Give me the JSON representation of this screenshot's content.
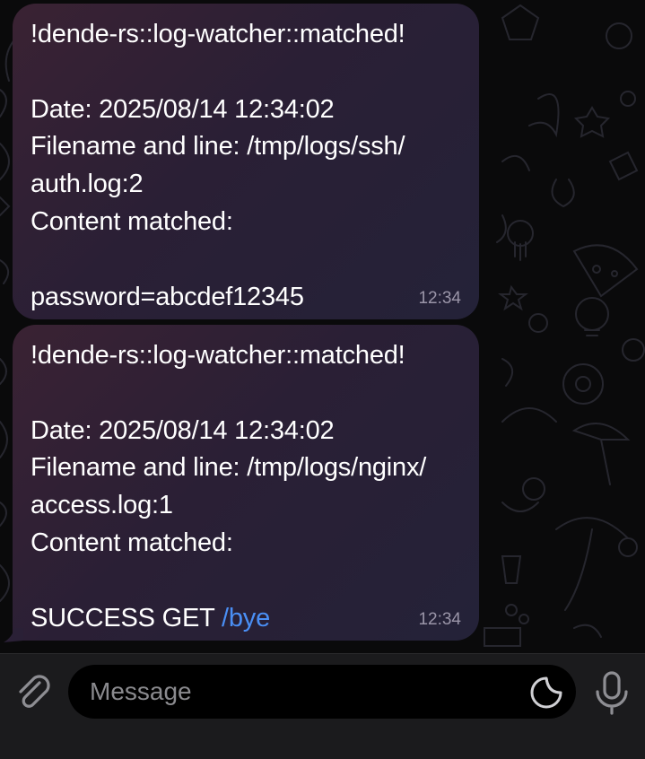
{
  "messages": [
    {
      "lines": [
        "!dende-rs::log-watcher::matched!",
        "",
        "Date: 2025/08/14 12:34:02",
        "Filename and line: /tmp/logs/ssh/",
        "auth.log:2",
        "Content matched:",
        "",
        "password=abcdef12345"
      ],
      "time": "12:34"
    },
    {
      "lines": [
        "!dende-rs::log-watcher::matched!",
        "",
        "Date: 2025/08/14 12:34:02",
        "Filename and line: /tmp/logs/nginx/",
        "access.log:1",
        "Content matched:",
        ""
      ],
      "last_line_prefix": "SUCCESS GET ",
      "last_line_command": "/bye",
      "time": "12:34"
    }
  ],
  "input": {
    "placeholder": "Message",
    "value": ""
  },
  "icons": {
    "attach": "paperclip-icon",
    "sticker": "sticker-icon",
    "mic": "microphone-icon"
  },
  "colors": {
    "link": "#4a8ff5",
    "bubble": "#2a1f35",
    "background": "#0a0a0b"
  }
}
